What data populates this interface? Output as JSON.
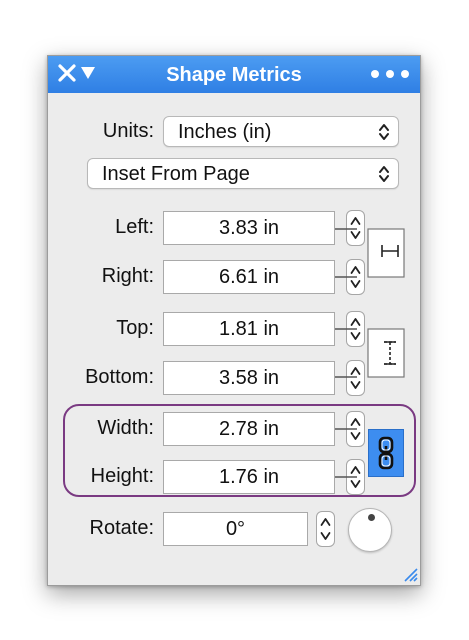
{
  "window": {
    "title": "Shape Metrics",
    "close_icon": "close-icon",
    "menu_icon": "chevron-down-icon",
    "more_icon": "more-icon",
    "accent": "#3a8aec"
  },
  "units": {
    "label": "Units:",
    "value": "Inches (in)"
  },
  "reference": {
    "value": "Inset From Page"
  },
  "position": {
    "left": {
      "label": "Left:",
      "value": "3.83 in"
    },
    "right": {
      "label": "Right:",
      "value": "6.61 in"
    },
    "top": {
      "label": "Top:",
      "value": "1.81 in"
    },
    "bottom": {
      "label": "Bottom:",
      "value": "3.58 in"
    }
  },
  "size": {
    "width": {
      "label": "Width:",
      "value": "2.78 in"
    },
    "height": {
      "label": "Height:",
      "value": "1.76 in"
    },
    "constrain_proportions": true,
    "constrain_color": "#3d8df0",
    "outline_color": "#7a3a82"
  },
  "rotate": {
    "label": "Rotate:",
    "value": "0°"
  }
}
